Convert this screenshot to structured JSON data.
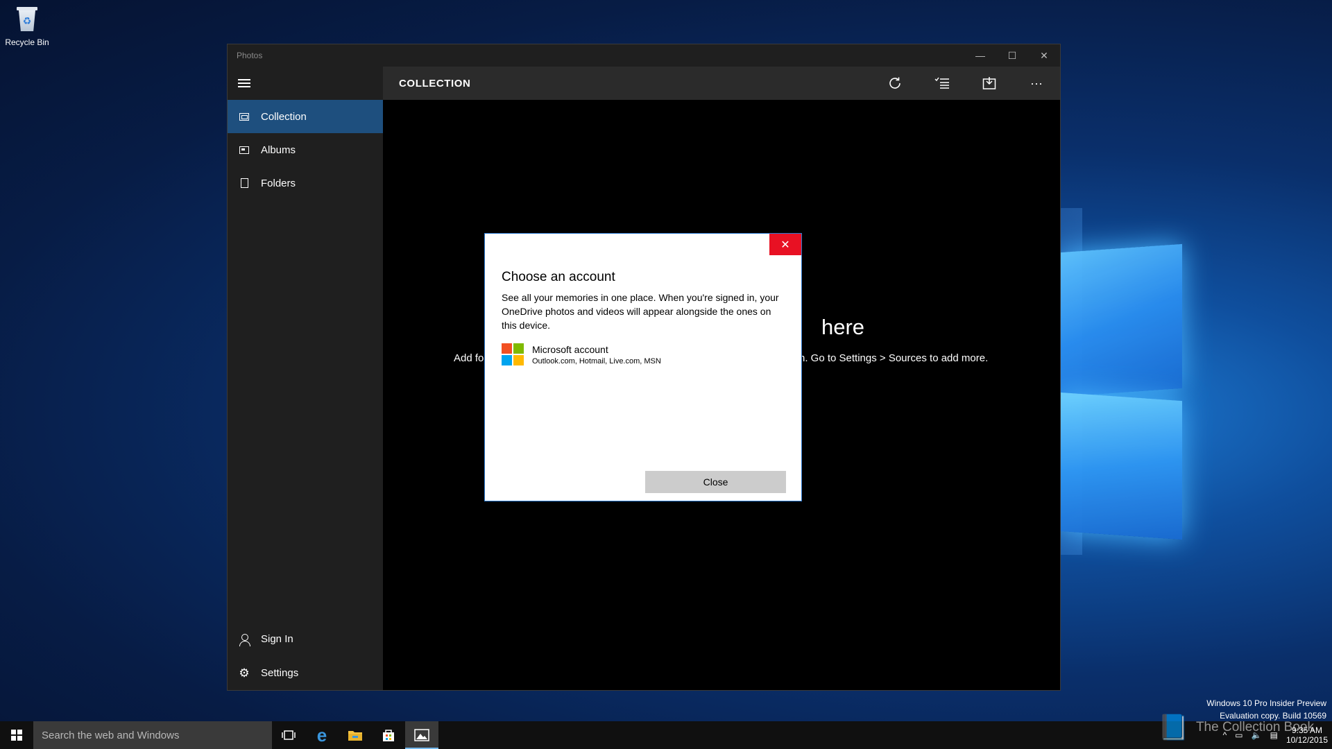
{
  "desktop": {
    "recycle_bin_label": "Recycle Bin"
  },
  "window": {
    "title": "Photos",
    "controls": {
      "minimize": "—",
      "maximize": "☐",
      "close": "✕"
    }
  },
  "sidebar": {
    "items": [
      {
        "label": "Collection",
        "icon": "collection-icon",
        "active": true
      },
      {
        "label": "Albums",
        "icon": "albums-icon",
        "active": false
      },
      {
        "label": "Folders",
        "icon": "folder-icon",
        "active": false
      }
    ],
    "bottom_items": [
      {
        "label": "Sign In",
        "icon": "person-icon"
      },
      {
        "label": "Settings",
        "icon": "gear-icon"
      }
    ]
  },
  "main": {
    "header_title": "COLLECTION",
    "actions": [
      "refresh-icon",
      "select-icon",
      "import-icon",
      "more-icon"
    ],
    "more_label": "···",
    "empty_title": "here",
    "empty_sub_left": "Add fo",
    "empty_sub_right": "n. Go to Settings > Sources to add more."
  },
  "dialog": {
    "title": "Choose an account",
    "body": "See all your memories in one place. When you're signed in, your OneDrive photos and videos will appear alongside the ones on this device.",
    "account_name": "Microsoft account",
    "account_sub": "Outlook.com, Hotmail, Live.com, MSN",
    "close_button": "Close",
    "close_glyph": "✕",
    "logo_colors": [
      "#f25022",
      "#7fba00",
      "#00a4ef",
      "#ffb900"
    ]
  },
  "watermark": {
    "line1": "Windows 10 Pro Insider Preview",
    "line2": "Evaluation copy. Build 10569",
    "brand": "The Collection Book"
  },
  "taskbar": {
    "search_placeholder": "Search the web and Windows",
    "time": "9:35 AM",
    "date": "10/12/2015",
    "accent": "#76b9ed"
  }
}
